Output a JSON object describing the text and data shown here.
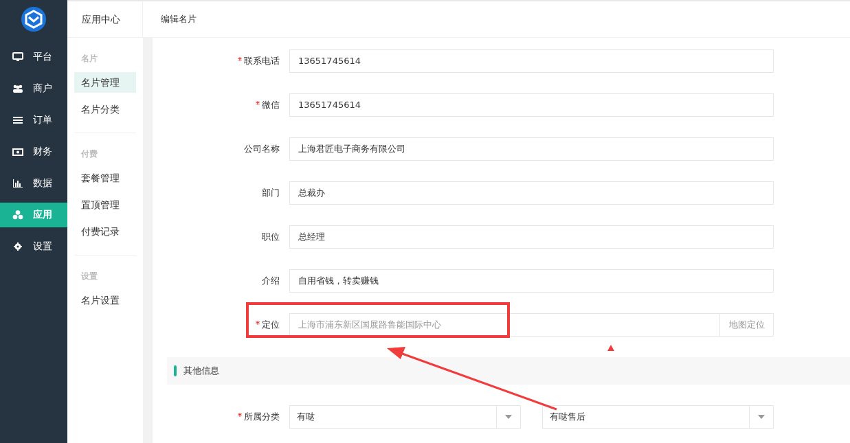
{
  "nav": {
    "items": [
      {
        "label": "平台",
        "kind": "monitor",
        "selected": false
      },
      {
        "label": "商户",
        "kind": "users",
        "selected": false
      },
      {
        "label": "订单",
        "kind": "list",
        "selected": false
      },
      {
        "label": "财务",
        "kind": "money",
        "selected": false
      },
      {
        "label": "数据",
        "kind": "chart",
        "selected": false
      },
      {
        "label": "应用",
        "kind": "cubes",
        "selected": true
      },
      {
        "label": "设置",
        "kind": "gear",
        "selected": false
      }
    ]
  },
  "subnav": {
    "title": "应用中心",
    "groups": [
      {
        "heading": "名片",
        "items": [
          {
            "label": "名片管理",
            "selected": true
          },
          {
            "label": "名片分类",
            "selected": false
          }
        ]
      },
      {
        "heading": "付费",
        "items": [
          {
            "label": "套餐管理",
            "selected": false
          },
          {
            "label": "置顶管理",
            "selected": false
          },
          {
            "label": "付费记录",
            "selected": false
          }
        ]
      },
      {
        "heading": "设置",
        "items": [
          {
            "label": "名片设置",
            "selected": false
          }
        ]
      }
    ]
  },
  "page": {
    "title": "编辑名片"
  },
  "form": {
    "fields": [
      {
        "label": "联系电话",
        "required": true,
        "kind": "text",
        "value": "13651745614"
      },
      {
        "label": "微信",
        "required": true,
        "kind": "text",
        "value": "13651745614"
      },
      {
        "label": "公司名称",
        "required": false,
        "kind": "text",
        "value": "上海君匠电子商务有限公司"
      },
      {
        "label": "部门",
        "required": false,
        "kind": "text",
        "value": "总裁办"
      },
      {
        "label": "职位",
        "required": false,
        "kind": "text",
        "value": "总经理"
      },
      {
        "label": "介绍",
        "required": false,
        "kind": "text",
        "value": "自用省钱，转卖赚钱"
      },
      {
        "label": "定位",
        "required": true,
        "kind": "addon",
        "placeholder": "上海市浦东新区国展路鲁能国际中心",
        "addon": "地图定位"
      }
    ]
  },
  "section": {
    "title": "其他信息"
  },
  "category": {
    "label": "所属分类",
    "required": true,
    "selects": [
      {
        "value": "有哒"
      },
      {
        "value": "有哒售后"
      }
    ]
  }
}
